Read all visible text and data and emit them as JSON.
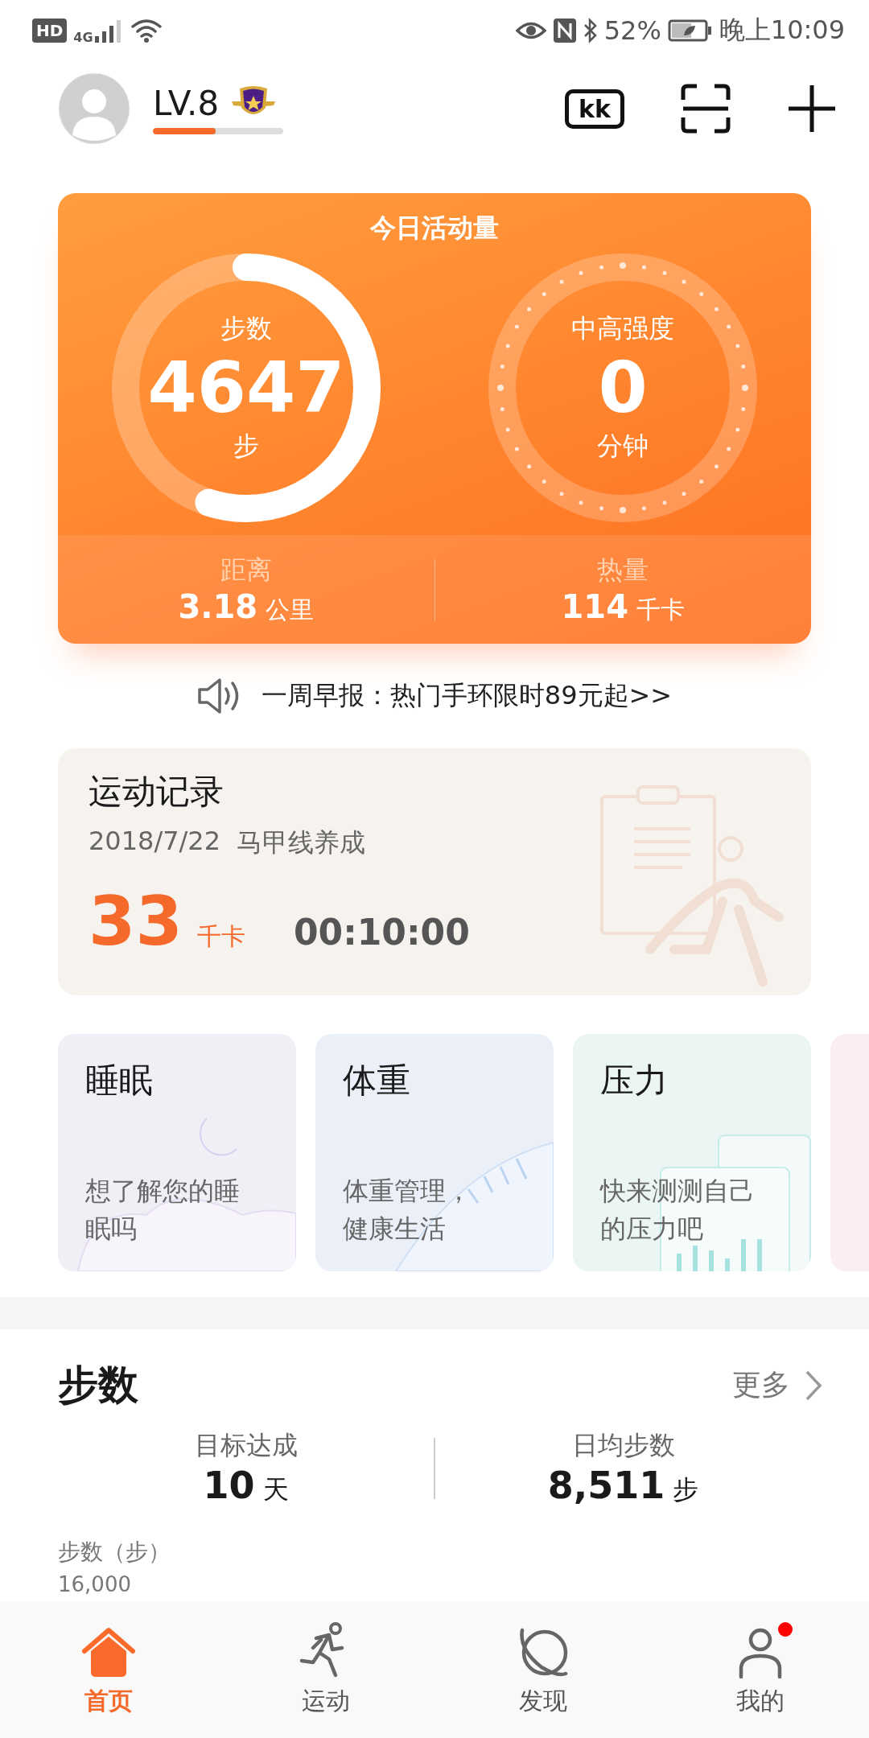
{
  "status_bar": {
    "hd": "HD",
    "network": "4G",
    "battery_percent": "52%",
    "time": "晚上10:09"
  },
  "header": {
    "level": "LV.8",
    "level_progress": {
      "level": 0.48
    },
    "ticket_label": "kk"
  },
  "activity": {
    "title": "今日活动量",
    "steps": {
      "label": "步数",
      "value": "4647",
      "unit": "步"
    },
    "intensity": {
      "label": "中高强度",
      "value": "0",
      "unit": "分钟"
    },
    "stats": [
      {
        "label": "距离",
        "value": "3.18",
        "unit": "公里"
      },
      {
        "label": "热量",
        "value": "114",
        "unit": "千卡"
      }
    ]
  },
  "report": "一周早报：热门手环限时89元起>>",
  "record": {
    "title": "运动记录",
    "date": "2018/7/22",
    "name": "马甲线养成",
    "calories": "33",
    "calories_unit": "千卡",
    "duration": "00:10:00"
  },
  "health_cards": [
    {
      "kind": "sleep",
      "title": "睡眠",
      "text_lines": [
        "想了解您的睡",
        "眠吗"
      ],
      "color": "#f1eff6"
    },
    {
      "kind": "weight",
      "title": "体重",
      "text_lines": [
        "体重管理，",
        "健康生活"
      ],
      "color": "#ebf0f8"
    },
    {
      "kind": "stress",
      "title": "压力",
      "text_lines": [
        "快来测测自己",
        "的压力吧"
      ],
      "color": "#ebf5f3"
    },
    {
      "kind": "partial",
      "color": "#fbeef0"
    }
  ],
  "steps_section": {
    "title": "步数",
    "more": "更多",
    "stats": [
      {
        "label": "目标达成",
        "value": "10",
        "unit": "天"
      },
      {
        "label": "日均步数",
        "value": "8,511",
        "unit": "步"
      }
    ],
    "chart_label": "步数（步）",
    "axis_tick": "16,000"
  },
  "nav": [
    {
      "label": "首页",
      "kind": "home",
      "selected": true,
      "badge": false
    },
    {
      "label": "运动",
      "kind": "run",
      "selected": false,
      "badge": false
    },
    {
      "label": "发现",
      "kind": "planet",
      "selected": false,
      "badge": false
    },
    {
      "label": "我的",
      "kind": "person",
      "selected": false,
      "badge": true
    }
  ]
}
